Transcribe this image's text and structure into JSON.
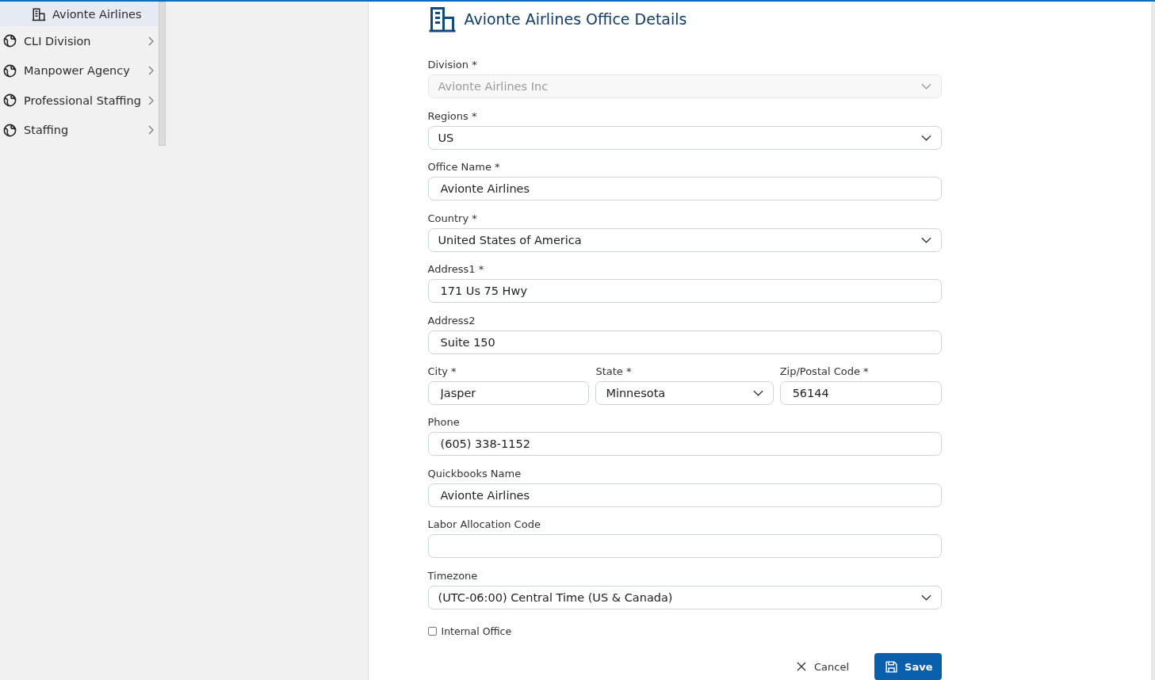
{
  "sidebar": {
    "items": [
      {
        "label": "Avionte Airlines",
        "kind": "office",
        "selected": true
      },
      {
        "label": "CLI Division",
        "kind": "division",
        "selected": false
      },
      {
        "label": "Manpower Agency",
        "kind": "division",
        "selected": false
      },
      {
        "label": "Professional Staffing",
        "kind": "division",
        "selected": false
      },
      {
        "label": "Staffing",
        "kind": "division",
        "selected": false
      }
    ]
  },
  "form": {
    "title": "Avionte Airlines Office Details",
    "fields": [
      {
        "kind": "select",
        "label": "Division *",
        "value": "Avionte Airlines Inc",
        "disabled": true
      },
      {
        "kind": "select",
        "label": "Regions *",
        "value": "US",
        "disabled": false
      },
      {
        "kind": "text",
        "label": "Office Name *",
        "value": "Avionte Airlines",
        "disabled": false
      },
      {
        "kind": "select",
        "label": "Country *",
        "value": "United States of America",
        "disabled": false
      },
      {
        "kind": "text",
        "label": "Address1 *",
        "value": "171 Us 75 Hwy",
        "disabled": false
      },
      {
        "kind": "text",
        "label": "Address2",
        "value": "Suite 150",
        "disabled": false
      },
      {
        "kind": "group",
        "fields": [
          {
            "kind": "text",
            "label": "City *",
            "value": "Jasper",
            "disabled": false
          },
          {
            "kind": "select",
            "label": "State *",
            "value": "Minnesota",
            "disabled": false
          },
          {
            "kind": "text",
            "label": "Zip/Postal Code *",
            "value": "56144",
            "disabled": false
          }
        ]
      },
      {
        "kind": "text",
        "label": "Phone",
        "value": "(605) 338-1152",
        "disabled": false
      },
      {
        "kind": "text",
        "label": "Quickbooks Name",
        "value": "Avionte Airlines",
        "disabled": false
      },
      {
        "kind": "text",
        "label": "Labor Allocation Code",
        "disabled": false
      },
      {
        "kind": "select",
        "label": "Timezone",
        "value": "(UTC-06:00) Central Time (US & Canada)",
        "disabled": false
      }
    ],
    "checkbox": {
      "label": "Internal Office",
      "checked": false
    },
    "buttons": {
      "cancel": "Cancel",
      "save": "Save"
    }
  }
}
